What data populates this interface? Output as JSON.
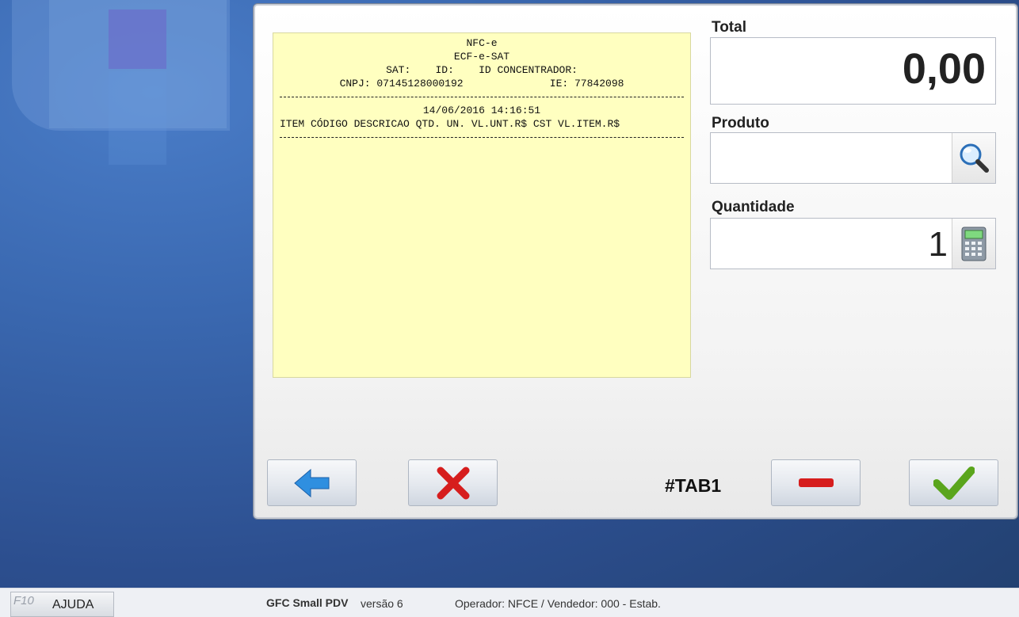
{
  "receipt": {
    "lines": [
      "NFC-e",
      "ECF-e-SAT",
      "SAT:    ID:    ID CONCENTRADOR:",
      "CNPJ: 07145128000192              IE: 77842098"
    ],
    "datetime": "14/06/2016 14:16:51",
    "columns_header": "ITEM CÓDIGO DESCRICAO QTD. UN. VL.UNT.R$ CST VL.ITEM.R$"
  },
  "total": {
    "label": "Total",
    "value": "0,00"
  },
  "produto": {
    "label": "Produto",
    "value": "",
    "search_icon": "search-icon"
  },
  "quantidade": {
    "label": "Quantidade",
    "value": "1",
    "calc_icon": "calculator-icon"
  },
  "actions": {
    "back_icon": "arrow-left-icon",
    "cancel_icon": "close-icon",
    "tab_label": "#TAB1",
    "remove_icon": "minus-icon",
    "confirm_icon": "check-icon"
  },
  "status": {
    "help_key": "F10",
    "help_label": "AJUDA",
    "app_name": "GFC Small PDV",
    "version": "versão 6",
    "operator": "Operador: NFCE / Vendedor: 000 - Estab."
  },
  "colors": {
    "receipt_bg": "#ffffc0",
    "accent_blue": "#2f8fe0",
    "cancel_red": "#d61d1d",
    "confirm_green": "#5aa51c"
  }
}
